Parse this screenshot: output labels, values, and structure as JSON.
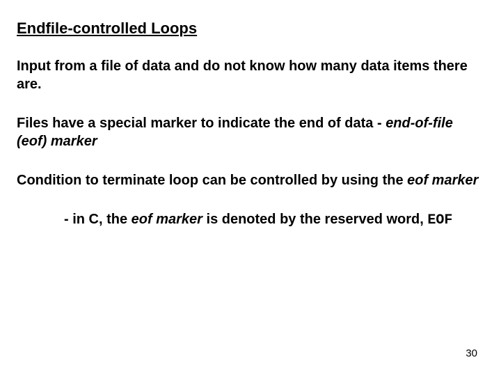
{
  "heading": "Endfile-controlled Loops",
  "p1": "Input from a file of data and do not know how many data items there are.",
  "p2a": "Files have a special marker to indicate the end of data - ",
  "p2b_italic": "end-of-file (eof) marker",
  "p3a": "Condition to terminate loop can be controlled by using the ",
  "p3b_italic": "eof marker",
  "p4a": "- in C, the ",
  "p4b_italic": "eof marker",
  "p4c": " is denoted by the reserved word, ",
  "p4d_mono": "EOF",
  "page_number": "30"
}
